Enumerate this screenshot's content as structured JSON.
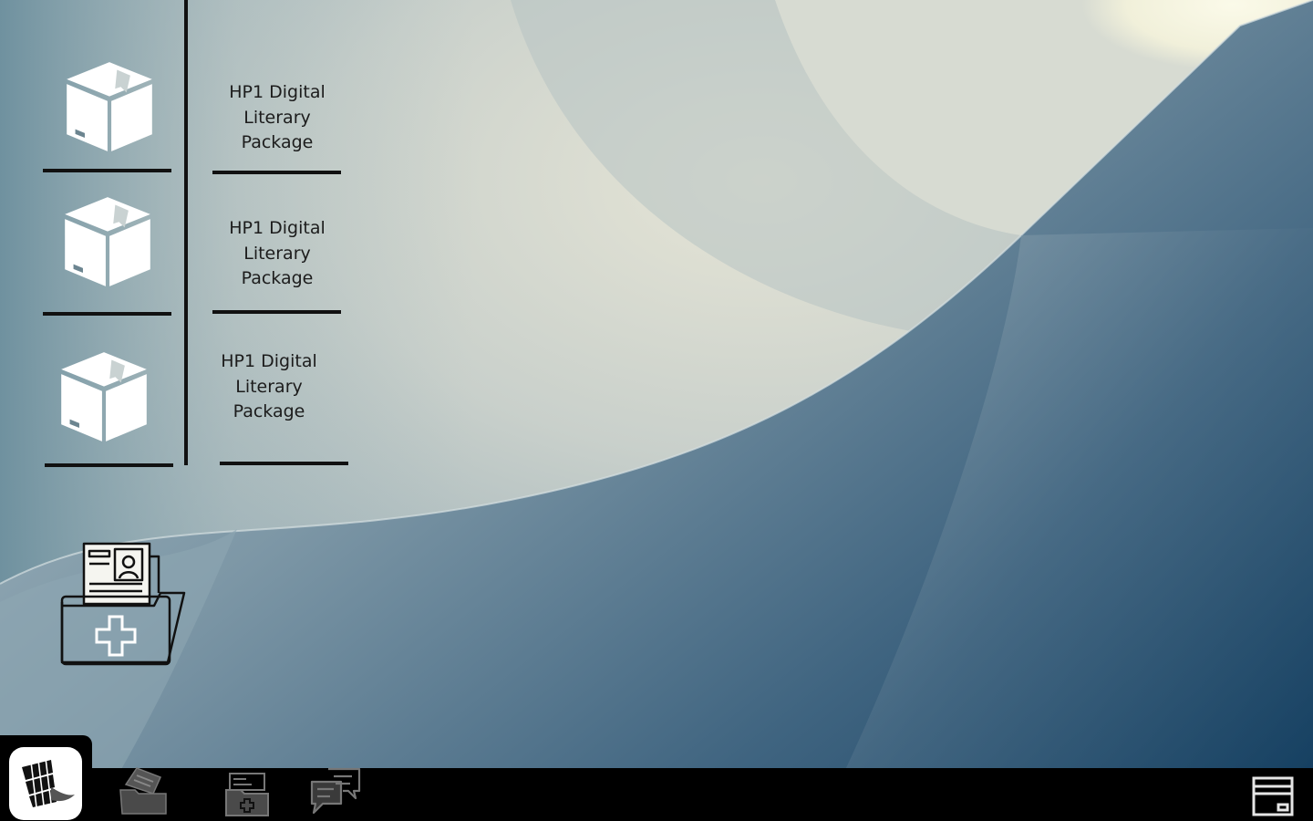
{
  "desktop": {
    "packages": [
      {
        "label": "HP1 Digital Literary Package",
        "icon": "package-box-icon"
      },
      {
        "label": "HP1 Digital Literary Package",
        "icon": "package-box-icon"
      },
      {
        "label": "HP1 Digital Literary Package",
        "icon": "package-box-icon"
      }
    ],
    "record_icon": "medical-record-folder-icon"
  },
  "taskbar": {
    "start_icon": "wave-grid-logo-icon",
    "apps": [
      {
        "icon": "documents-folder-icon"
      },
      {
        "icon": "medical-files-icon"
      },
      {
        "icon": "chat-bubbles-icon"
      }
    ],
    "tray_icon": "window-panel-icon"
  },
  "colors": {
    "taskbar": "#000000",
    "icon_fill": "#ffffff",
    "ink": "#111111"
  }
}
